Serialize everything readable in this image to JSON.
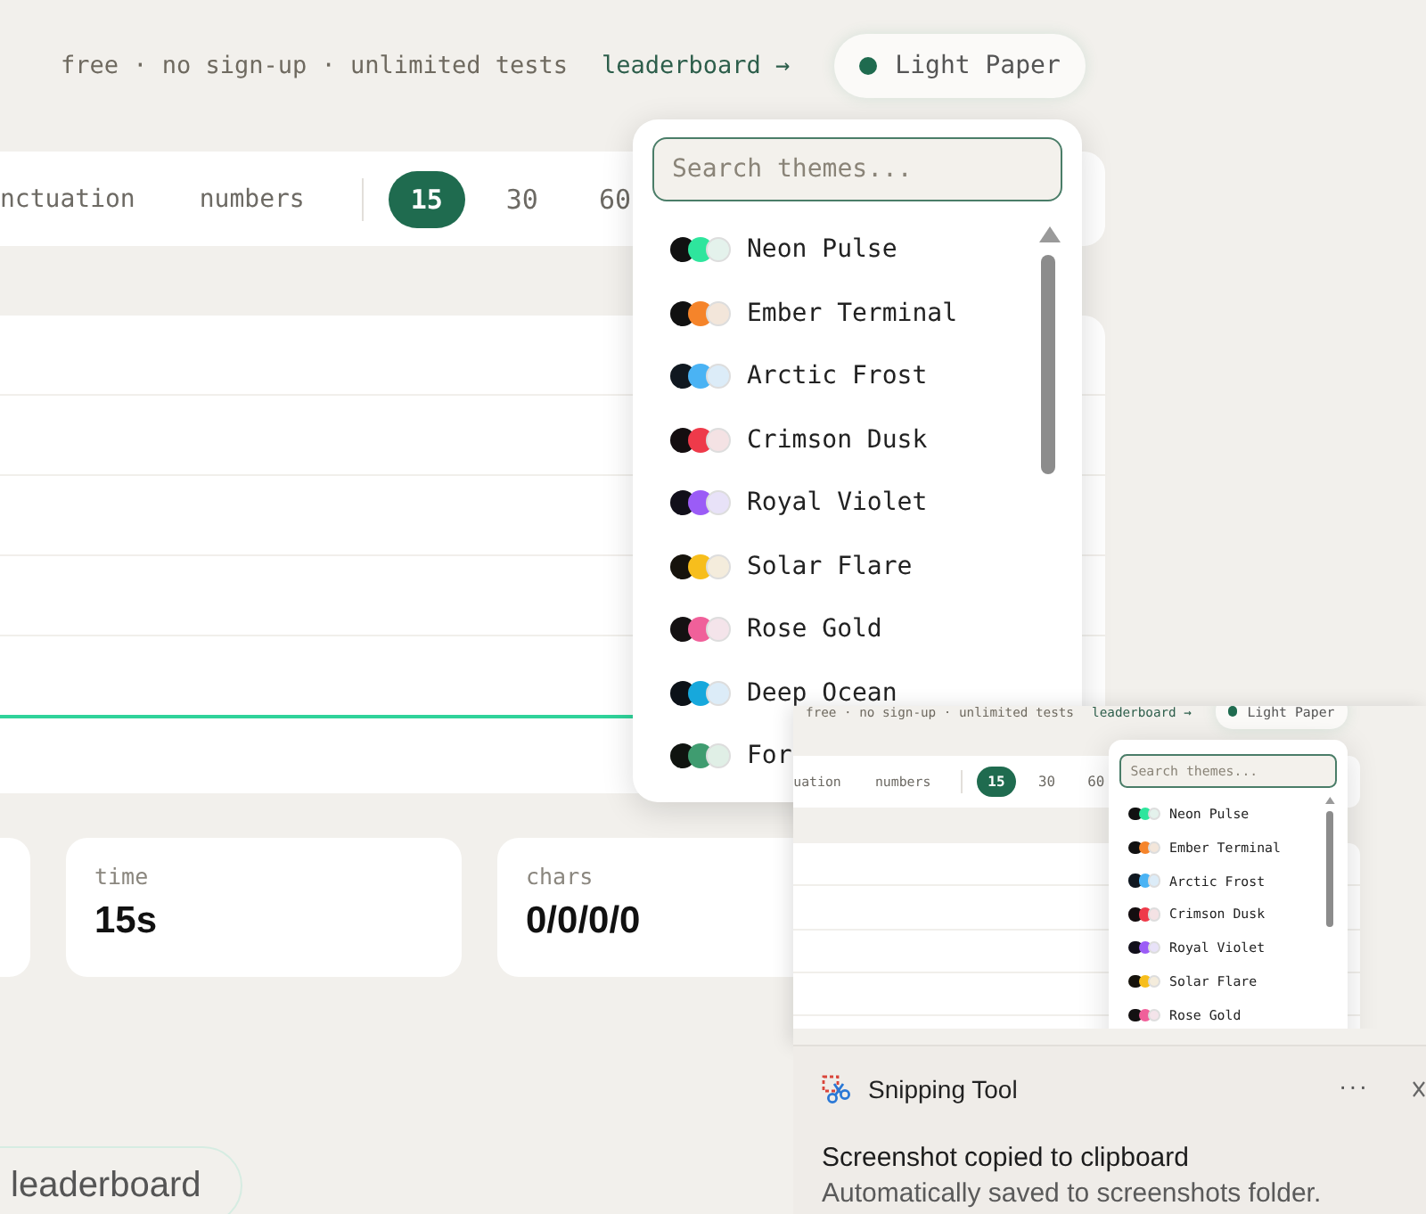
{
  "header": {
    "tagline": "free · no sign-up · unlimited tests",
    "leaderboard_link": "leaderboard →",
    "theme_button": "Light Paper"
  },
  "mode_bar": {
    "options": [
      {
        "label": "nctuation",
        "selected": false
      },
      {
        "label": "numbers",
        "selected": false
      }
    ],
    "durations": [
      {
        "label": "15",
        "selected": true
      },
      {
        "label": "30",
        "selected": false
      },
      {
        "label": "60",
        "selected": false
      }
    ]
  },
  "stats": [
    {
      "kind": "empty"
    },
    {
      "kind": "stat",
      "label": "time",
      "value": "15s"
    },
    {
      "kind": "stat",
      "label": "chars",
      "value": "0/0/0/0"
    }
  ],
  "leaderboard_button": "leaderboard",
  "theme_menu": {
    "placeholder": "Search themes...",
    "themes": [
      {
        "name": "Neon Pulse",
        "swatches": [
          {
            "color": "#111111"
          },
          {
            "color": "#2ee59d"
          },
          {
            "color": "#e4f2ec"
          }
        ]
      },
      {
        "name": "Ember Terminal",
        "swatches": [
          {
            "color": "#111111"
          },
          {
            "color": "#f5842a"
          },
          {
            "color": "#f3e6da"
          }
        ]
      },
      {
        "name": "Arctic Frost",
        "swatches": [
          {
            "color": "#101820"
          },
          {
            "color": "#4ab3f4"
          },
          {
            "color": "#dcecf8"
          }
        ]
      },
      {
        "name": "Crimson Dusk",
        "swatches": [
          {
            "color": "#140e10"
          },
          {
            "color": "#ee3a4a"
          },
          {
            "color": "#f4e2e4"
          }
        ]
      },
      {
        "name": "Royal Violet",
        "swatches": [
          {
            "color": "#110f1a"
          },
          {
            "color": "#9b5cf6"
          },
          {
            "color": "#e8e2f8"
          }
        ]
      },
      {
        "name": "Solar Flare",
        "swatches": [
          {
            "color": "#16130c"
          },
          {
            "color": "#f7be1c"
          },
          {
            "color": "#f4ecdc"
          }
        ]
      },
      {
        "name": "Rose Gold",
        "swatches": [
          {
            "color": "#141112"
          },
          {
            "color": "#f0609a"
          },
          {
            "color": "#f4e4ea"
          }
        ]
      },
      {
        "name": "Deep Ocean",
        "swatches": [
          {
            "color": "#0c1218"
          },
          {
            "color": "#17a8dc"
          },
          {
            "color": "#dcecf8"
          }
        ]
      },
      {
        "name": "For",
        "swatches": [
          {
            "color": "#101410"
          },
          {
            "color": "#3f9c70"
          },
          {
            "color": "#e0efe6"
          }
        ]
      }
    ]
  },
  "clipboard_preview": {
    "header": {
      "tagline": "free · no sign-up · unlimited tests",
      "leaderboard_link": "leaderboard →",
      "theme_button": "Light Paper"
    },
    "mode_bar": {
      "options": [
        {
          "label": "uation",
          "selected": false
        },
        {
          "label": "numbers",
          "selected": false
        }
      ],
      "durations": [
        {
          "label": "15",
          "selected": true
        },
        {
          "label": "30",
          "selected": false
        },
        {
          "label": "60",
          "selected": false
        }
      ]
    },
    "theme_menu": {
      "placeholder": "Search themes...",
      "themes": [
        {
          "name": "Neon Pulse",
          "swatches": [
            {
              "color": "#111111"
            },
            {
              "color": "#2ee59d"
            },
            {
              "color": "#e4f2ec"
            }
          ]
        },
        {
          "name": "Ember Terminal",
          "swatches": [
            {
              "color": "#111111"
            },
            {
              "color": "#f5842a"
            },
            {
              "color": "#f3e6da"
            }
          ]
        },
        {
          "name": "Arctic Frost",
          "swatches": [
            {
              "color": "#101820"
            },
            {
              "color": "#4ab3f4"
            },
            {
              "color": "#dcecf8"
            }
          ]
        },
        {
          "name": "Crimson Dusk",
          "swatches": [
            {
              "color": "#140e10"
            },
            {
              "color": "#ee3a4a"
            },
            {
              "color": "#f4e2e4"
            }
          ]
        },
        {
          "name": "Royal Violet",
          "swatches": [
            {
              "color": "#110f1a"
            },
            {
              "color": "#9b5cf6"
            },
            {
              "color": "#e8e2f8"
            }
          ]
        },
        {
          "name": "Solar Flare",
          "swatches": [
            {
              "color": "#16130c"
            },
            {
              "color": "#f7be1c"
            },
            {
              "color": "#f4ecdc"
            }
          ]
        },
        {
          "name": "Rose Gold",
          "swatches": [
            {
              "color": "#141112"
            },
            {
              "color": "#f0609a"
            },
            {
              "color": "#f4e4ea"
            }
          ]
        }
      ]
    }
  },
  "notification": {
    "app": "Snipping Tool",
    "more_button": "···",
    "title": "Screenshot copied to clipboard",
    "message": "Automatically saved to screenshots folder."
  }
}
